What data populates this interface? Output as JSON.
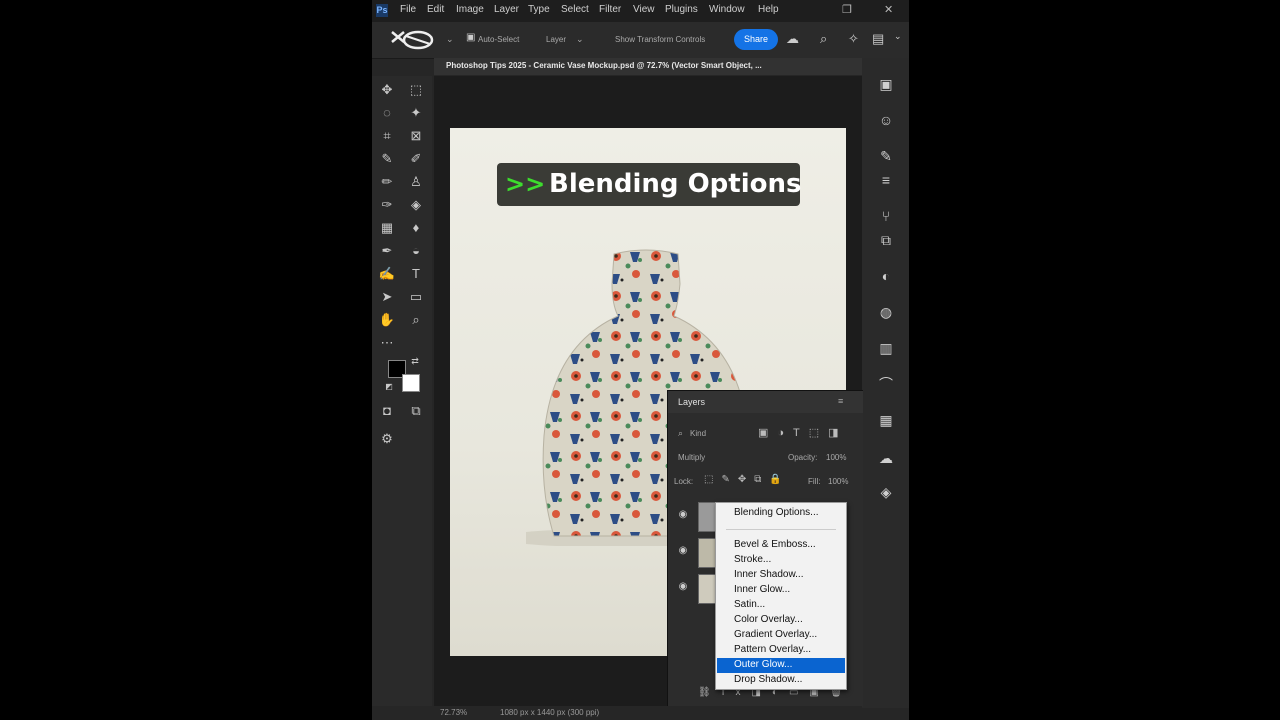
{
  "menu": [
    "File",
    "Edit",
    "Image",
    "Layer",
    "Type",
    "Select",
    "Filter",
    "View",
    "Plugins",
    "Window",
    "Help"
  ],
  "options": {
    "auto_select": "Auto-Select",
    "layer_select": "Layer",
    "show_transform": "Show Transform Controls",
    "share": "Share"
  },
  "document": {
    "title": "Photoshop Tips 2025 - Ceramic Vase Mockup.psd @ 72.7% (Vector Smart Object, ..."
  },
  "canvas": {
    "banner_arrows": ">>",
    "banner_text": "Blending Options"
  },
  "layers_panel": {
    "title": "Layers",
    "kind": "Kind",
    "blend_mode": "Multiply",
    "opacity_label": "Opacity:",
    "opacity_value": "100%",
    "lock_label": "Lock:",
    "fill_label": "Fill:",
    "fill_value": "100%"
  },
  "context_menu": {
    "items": [
      "Blending Options...",
      "Bevel & Emboss...",
      "Stroke...",
      "Inner Shadow...",
      "Inner Glow...",
      "Satin...",
      "Color Overlay...",
      "Gradient Overlay...",
      "Pattern Overlay...",
      "Outer Glow...",
      "Drop Shadow..."
    ],
    "selected": "Outer Glow..."
  },
  "status": {
    "zoom": "72.73%",
    "size": "1080 px x 1440 px (300 ppi)"
  },
  "colors": {
    "accent": "#1473e6",
    "banner_green": "#3ddc2e",
    "menu_highlight": "#0a64d0"
  }
}
